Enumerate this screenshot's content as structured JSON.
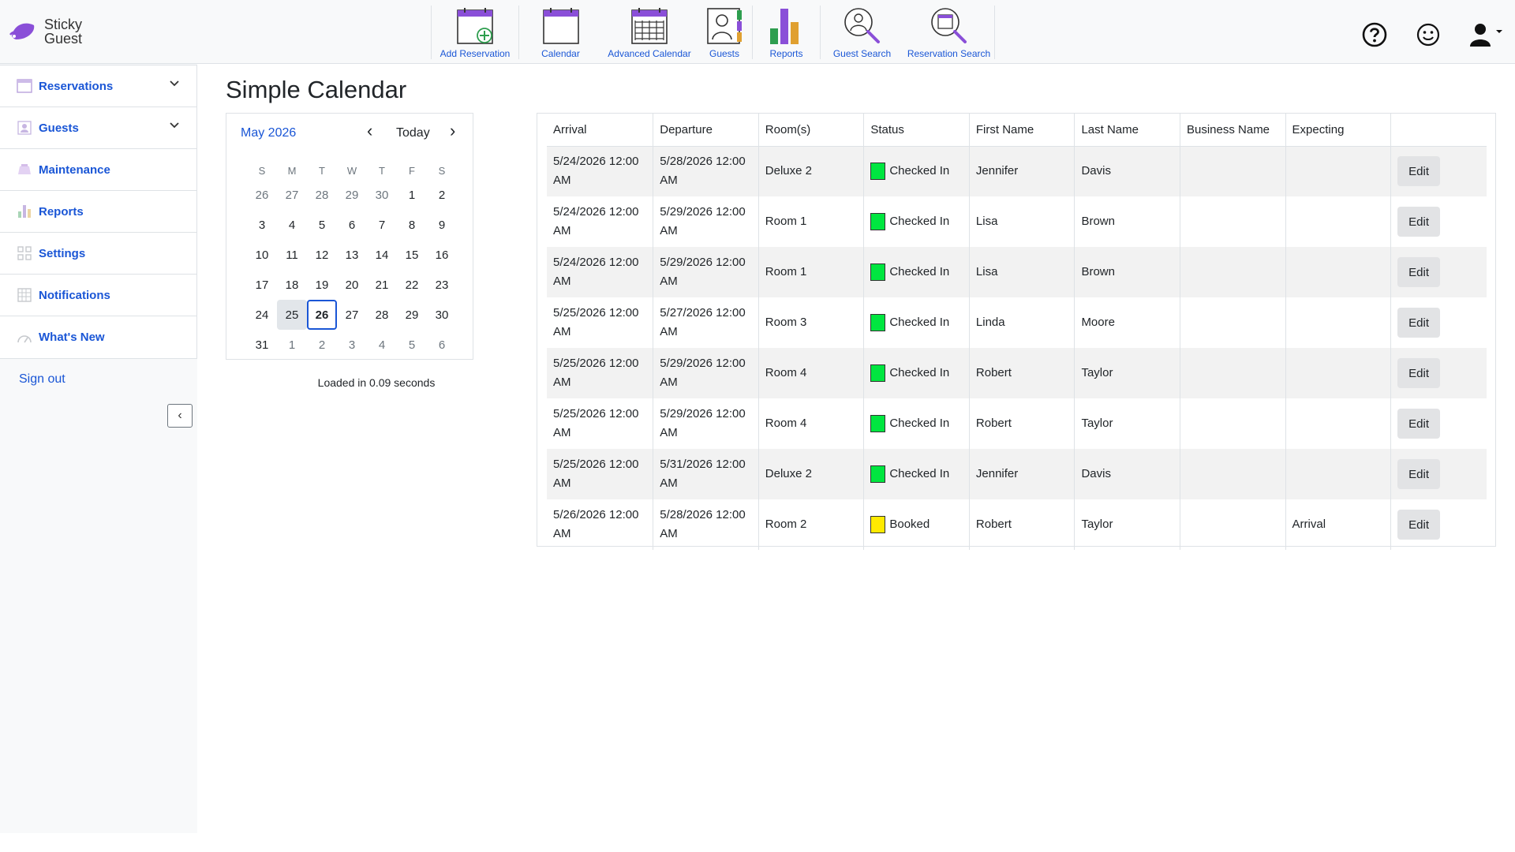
{
  "brand": {
    "line1": "Sticky",
    "line2": "Guest"
  },
  "toolbar": [
    {
      "label": "Add Reservation",
      "icon": "calendar-add-icon"
    },
    {
      "label": "Calendar",
      "icon": "calendar-icon"
    },
    {
      "label": "Advanced Calendar",
      "icon": "calendar-grid-icon"
    },
    {
      "label": "Guests",
      "icon": "guest-book-icon"
    },
    {
      "label": "Reports",
      "icon": "bar-chart-icon"
    },
    {
      "label": "Guest Search",
      "icon": "person-search-icon"
    },
    {
      "label": "Reservation Search",
      "icon": "reservation-search-icon"
    }
  ],
  "sidebar": {
    "items": [
      {
        "label": "Reservations",
        "icon": "calendar-icon",
        "expandable": true
      },
      {
        "label": "Guests",
        "icon": "user-icon",
        "expandable": true
      },
      {
        "label": "Maintenance",
        "icon": "broom-icon",
        "expandable": false
      },
      {
        "label": "Reports",
        "icon": "bar-chart-icon",
        "expandable": false
      },
      {
        "label": "Settings",
        "icon": "grid-icon",
        "expandable": false
      },
      {
        "label": "Notifications",
        "icon": "table-icon",
        "expandable": false
      },
      {
        "label": "What's New",
        "icon": "gauge-icon",
        "expandable": false
      }
    ],
    "signout": "Sign out",
    "collapse_symbol": "‹"
  },
  "page": {
    "title": "Simple Calendar"
  },
  "calendar": {
    "month_label": "May 2026",
    "today_label": "Today",
    "prev_symbol": "‹",
    "next_symbol": "›",
    "weekdays": [
      "S",
      "M",
      "T",
      "W",
      "T",
      "F",
      "S"
    ],
    "weeks": [
      [
        [
          "26",
          1
        ],
        [
          "27",
          1
        ],
        [
          "28",
          1
        ],
        [
          "29",
          1
        ],
        [
          "30",
          1
        ],
        [
          "1",
          0
        ],
        [
          "2",
          0
        ]
      ],
      [
        [
          "3",
          0
        ],
        [
          "4",
          0
        ],
        [
          "5",
          0
        ],
        [
          "6",
          0
        ],
        [
          "7",
          0
        ],
        [
          "8",
          0
        ],
        [
          "9",
          0
        ]
      ],
      [
        [
          "10",
          0
        ],
        [
          "11",
          0
        ],
        [
          "12",
          0
        ],
        [
          "13",
          0
        ],
        [
          "14",
          0
        ],
        [
          "15",
          0
        ],
        [
          "16",
          0
        ]
      ],
      [
        [
          "17",
          0
        ],
        [
          "18",
          0
        ],
        [
          "19",
          0
        ],
        [
          "20",
          0
        ],
        [
          "21",
          0
        ],
        [
          "22",
          0
        ],
        [
          "23",
          0
        ]
      ],
      [
        [
          "24",
          0
        ],
        [
          "25",
          0
        ],
        [
          "26",
          0
        ],
        [
          "27",
          0
        ],
        [
          "28",
          0
        ],
        [
          "29",
          0
        ],
        [
          "30",
          0
        ]
      ],
      [
        [
          "31",
          0
        ],
        [
          "1",
          1
        ],
        [
          "2",
          1
        ],
        [
          "3",
          1
        ],
        [
          "4",
          1
        ],
        [
          "5",
          1
        ],
        [
          "6",
          1
        ]
      ]
    ],
    "selected_day": "25",
    "today_day": "26",
    "loaded_text": "Loaded in 0.09 seconds"
  },
  "reservations": {
    "columns": [
      "Arrival",
      "Departure",
      "Room(s)",
      "Status",
      "First Name",
      "Last Name",
      "Business Name",
      "Expecting",
      ""
    ],
    "edit_label": "Edit",
    "status_colors": {
      "Checked In": "#00e640",
      "Booked": "#ffea00"
    },
    "rows": [
      {
        "arrival": "5/24/2026 12:00 AM",
        "departure": "5/28/2026 12:00 AM",
        "room": "Deluxe 2",
        "status": "Checked In",
        "first": "Jennifer",
        "last": "Davis",
        "business": "",
        "expecting": ""
      },
      {
        "arrival": "5/24/2026 12:00 AM",
        "departure": "5/29/2026 12:00 AM",
        "room": "Room 1",
        "status": "Checked In",
        "first": "Lisa",
        "last": "Brown",
        "business": "",
        "expecting": ""
      },
      {
        "arrival": "5/24/2026 12:00 AM",
        "departure": "5/29/2026 12:00 AM",
        "room": "Room 1",
        "status": "Checked In",
        "first": "Lisa",
        "last": "Brown",
        "business": "",
        "expecting": ""
      },
      {
        "arrival": "5/25/2026 12:00 AM",
        "departure": "5/27/2026 12:00 AM",
        "room": "Room 3",
        "status": "Checked In",
        "first": "Linda",
        "last": "Moore",
        "business": "",
        "expecting": ""
      },
      {
        "arrival": "5/25/2026 12:00 AM",
        "departure": "5/29/2026 12:00 AM",
        "room": "Room 4",
        "status": "Checked In",
        "first": "Robert",
        "last": "Taylor",
        "business": "",
        "expecting": ""
      },
      {
        "arrival": "5/25/2026 12:00 AM",
        "departure": "5/29/2026 12:00 AM",
        "room": "Room 4",
        "status": "Checked In",
        "first": "Robert",
        "last": "Taylor",
        "business": "",
        "expecting": ""
      },
      {
        "arrival": "5/25/2026 12:00 AM",
        "departure": "5/31/2026 12:00 AM",
        "room": "Deluxe 2",
        "status": "Checked In",
        "first": "Jennifer",
        "last": "Davis",
        "business": "",
        "expecting": ""
      },
      {
        "arrival": "5/26/2026 12:00 AM",
        "departure": "5/28/2026 12:00 AM",
        "room": "Room 2",
        "status": "Booked",
        "first": "Robert",
        "last": "Taylor",
        "business": "",
        "expecting": "Arrival"
      }
    ]
  },
  "colors": {
    "link": "#1a56d6",
    "accent_purple": "#8a4fd8",
    "border": "#dee2e6"
  }
}
